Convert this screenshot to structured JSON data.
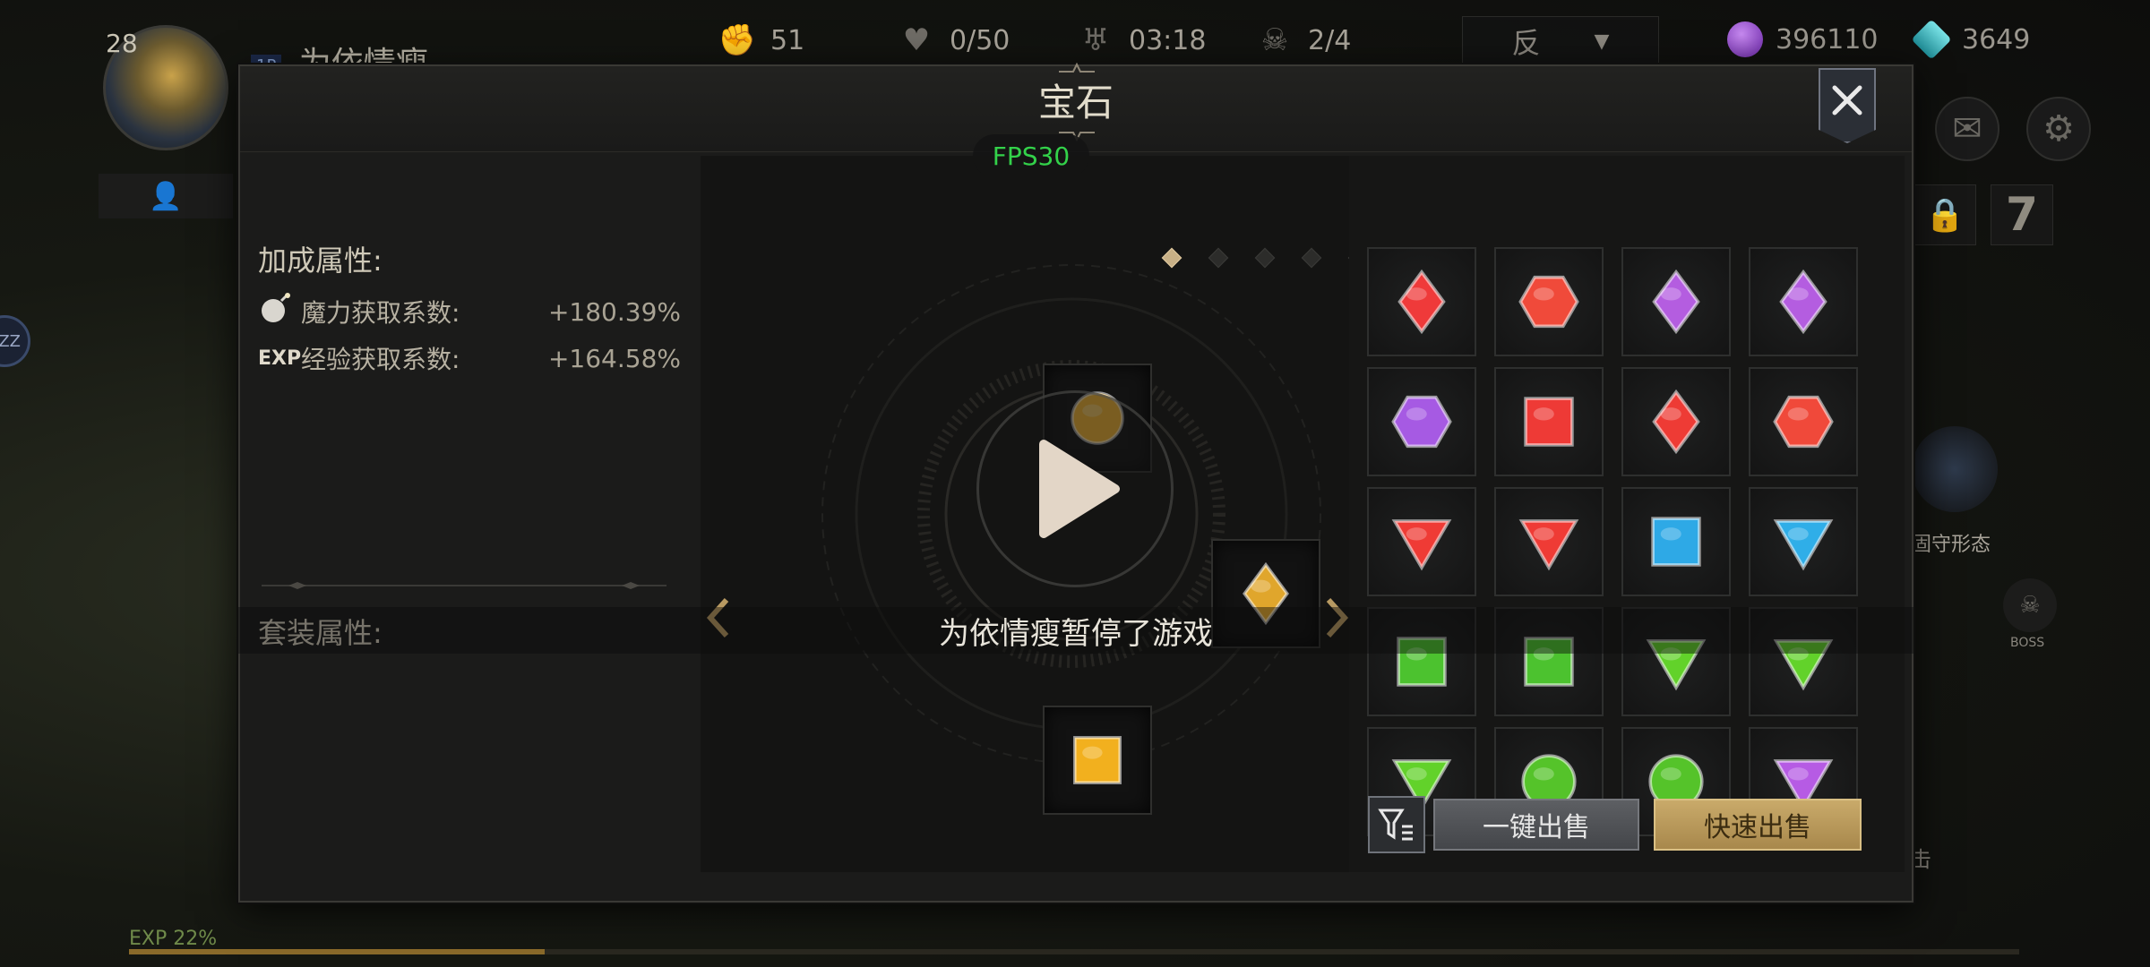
{
  "hud": {
    "level": "28",
    "player_tag": "1P",
    "player_name": "为依情瘦",
    "stats": [
      {
        "icon": "fist-icon",
        "value": "51"
      },
      {
        "icon": "heart-rate-icon",
        "value": "0/50"
      },
      {
        "icon": "demon-horns-icon",
        "value": "03:18"
      },
      {
        "icon": "skull-icon",
        "value": "2/4"
      }
    ],
    "dropdown_value": "反",
    "currencies": [
      {
        "icon": "purple-orb-icon",
        "value": "396110",
        "color": "#8a3fd0"
      },
      {
        "icon": "crystal-icon",
        "value": "3649",
        "color": "#3fb7c0"
      }
    ],
    "side_circle_label": "ZZ",
    "right_side": {
      "level_badge": "7",
      "guard_label": "固守形态",
      "boss_label": "BOSS",
      "partial_label": "击"
    },
    "exp_label": "EXP 22%",
    "exp_percent": 22
  },
  "modal": {
    "title": "宝石",
    "close_label": "✕",
    "bonus_section_title": "加成属性:",
    "attributes": [
      {
        "icon_text": "●",
        "name": "魔力获取系数:",
        "value": "+180.39%"
      },
      {
        "icon_text": "EXP",
        "name": "经验获取系数:",
        "value": "+164.58%"
      }
    ],
    "set_section_title": "套装属性:",
    "page_count": 5,
    "active_page": 0,
    "socketed_gems": [
      {
        "slot": "top-left",
        "shape": "circle",
        "color": "#f5b731"
      },
      {
        "slot": "top-right",
        "shape": "triangle",
        "color": "#f3a81f"
      },
      {
        "slot": "center",
        "shape": "diamond",
        "color": "#e0a62c"
      },
      {
        "slot": "bottom-left",
        "shape": "square",
        "color": "#f2b01e"
      },
      {
        "slot": "bottom-right",
        "shape": "hexagon",
        "color": "#f6bf24"
      }
    ],
    "inventory_gems": [
      {
        "shape": "diamond",
        "color": "#ef3a3a"
      },
      {
        "shape": "hexagon",
        "color": "#f04a3a"
      },
      {
        "shape": "diamond",
        "color": "#b45de0"
      },
      {
        "shape": "diamond",
        "color": "#b45de0"
      },
      {
        "shape": "hexagon",
        "color": "#a65ae3"
      },
      {
        "shape": "square",
        "color": "#ee3a36"
      },
      {
        "shape": "diamond",
        "color": "#ee3b35"
      },
      {
        "shape": "hexagon",
        "color": "#f0493a"
      },
      {
        "shape": "triangle",
        "color": "#ef3b35"
      },
      {
        "shape": "triangle",
        "color": "#ef3b35"
      },
      {
        "shape": "square",
        "color": "#2ea9e6"
      },
      {
        "shape": "triangle",
        "color": "#2faee8"
      },
      {
        "shape": "square",
        "color": "#4cc22f"
      },
      {
        "shape": "square",
        "color": "#4cc22f"
      },
      {
        "shape": "triangle",
        "color": "#62d22a"
      },
      {
        "shape": "triangle",
        "color": "#62d22a"
      },
      {
        "shape": "triangle",
        "color": "#62d22a"
      },
      {
        "shape": "circle",
        "color": "#55c32a"
      },
      {
        "shape": "circle",
        "color": "#55c32a"
      },
      {
        "shape": "triangle",
        "color": "#b65be4"
      }
    ],
    "sell_all_label": "一键出售",
    "quick_sell_label": "快速出售"
  },
  "overlay": {
    "fps": "FPS30",
    "pause_message": "为依情瘦暂停了游戏"
  }
}
